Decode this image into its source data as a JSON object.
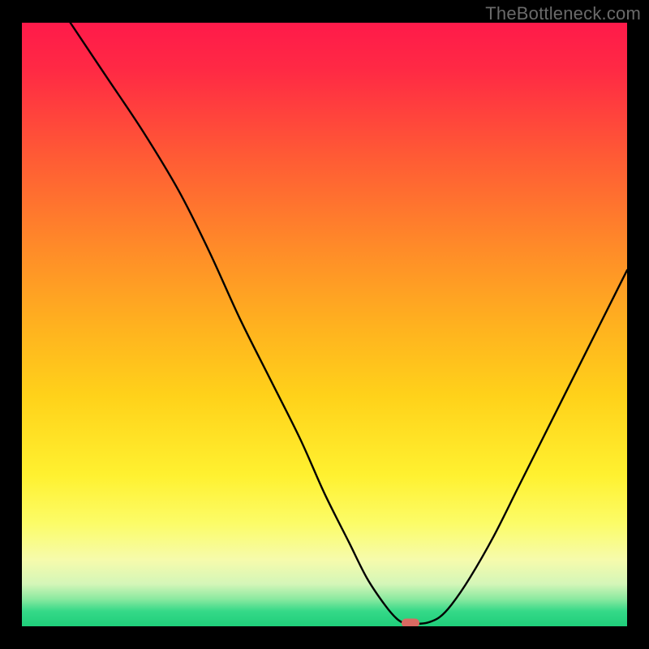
{
  "watermark": "TheBottleneck.com",
  "colors": {
    "background": "#000000",
    "marker": "#d96a62",
    "curve": "#000000",
    "gradient_stops": [
      {
        "pct": 0.0,
        "color": "#ff1a4a"
      },
      {
        "pct": 0.08,
        "color": "#ff2a44"
      },
      {
        "pct": 0.22,
        "color": "#ff5a35"
      },
      {
        "pct": 0.38,
        "color": "#ff8d28"
      },
      {
        "pct": 0.5,
        "color": "#ffb11f"
      },
      {
        "pct": 0.62,
        "color": "#ffd21a"
      },
      {
        "pct": 0.75,
        "color": "#fff130"
      },
      {
        "pct": 0.83,
        "color": "#fcfc68"
      },
      {
        "pct": 0.89,
        "color": "#f6fbac"
      },
      {
        "pct": 0.93,
        "color": "#d4f6b8"
      },
      {
        "pct": 0.955,
        "color": "#8ae9a0"
      },
      {
        "pct": 0.975,
        "color": "#35d988"
      },
      {
        "pct": 1.0,
        "color": "#1fce7a"
      }
    ]
  },
  "chart_data": {
    "type": "line",
    "title": "",
    "xlabel": "",
    "ylabel": "",
    "xlim": [
      0,
      100
    ],
    "ylim": [
      0,
      100
    ],
    "grid": false,
    "series": [
      {
        "name": "bottleneck-curve",
        "x": [
          8,
          14,
          20,
          26,
          31,
          36,
          41,
          46,
          50,
          54,
          57,
          60,
          62,
          63.5,
          65,
          67,
          69,
          71,
          74,
          78,
          82,
          86,
          90,
          94,
          98,
          100
        ],
        "y": [
          100,
          91,
          82,
          72,
          62,
          51,
          41,
          31,
          22,
          14,
          8,
          3.5,
          1.2,
          0.4,
          0.4,
          0.6,
          1.5,
          3.6,
          8,
          15,
          23,
          31,
          39,
          47,
          55,
          59
        ]
      }
    ],
    "annotations": [
      {
        "name": "optimal-marker",
        "x": 64.2,
        "y": 0.6
      }
    ]
  }
}
